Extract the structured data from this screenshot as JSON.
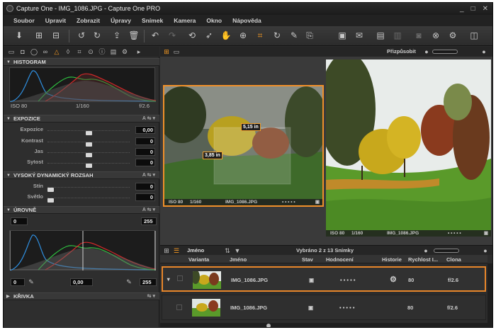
{
  "window": {
    "title": "Capture One - IMG_1086.JPG - Capture One PRO",
    "controls": [
      "_",
      "□",
      "✕"
    ]
  },
  "menu": [
    "Soubor",
    "Upravit",
    "Zobrazit",
    "Úpravy",
    "Snímek",
    "Kamera",
    "Okno",
    "Nápověda"
  ],
  "viewer_controls": {
    "customize_label": "Přizpůsobit"
  },
  "histogram": {
    "title": "HISTOGRAM",
    "iso": "ISO 80",
    "shutter": "1/160",
    "aperture": "f/2.6"
  },
  "exposure": {
    "title": "EXPOZICE",
    "rows": [
      {
        "label": "Expozice",
        "value": "0,00",
        "pos": 0.5
      },
      {
        "label": "Kontrast",
        "value": "0",
        "pos": 0.5
      },
      {
        "label": "Jas",
        "value": "0",
        "pos": 0.5
      },
      {
        "label": "Sytost",
        "value": "0",
        "pos": 0.5
      }
    ]
  },
  "hdr": {
    "title": "VYSOKÝ DYNAMICKÝ ROZSAH",
    "rows": [
      {
        "label": "Stín",
        "value": "0",
        "pos": 0
      },
      {
        "label": "Světlo",
        "value": "0",
        "pos": 0
      }
    ]
  },
  "levels": {
    "title": "ÚROVNĚ",
    "black_in": "0",
    "white_in": "255",
    "black_out": "0",
    "mid": "0,00",
    "white_out": "255"
  },
  "curve": {
    "title": "KŘIVKA"
  },
  "viewer": {
    "left_caption": {
      "iso": "ISO 80",
      "shutter": "1/160",
      "name": "IMG_1086.JPG"
    },
    "right_caption": {
      "iso": "ISO 80",
      "shutter": "1/160",
      "name": "IMG_1086.JPG"
    },
    "measure_w": "5,15 in",
    "measure_h": "3,85 in"
  },
  "browser": {
    "sort_label": "Jméno",
    "selection": "Vybráno 2 z 13 Snímky",
    "columns": [
      "Varianta",
      "Jméno",
      "Stav",
      "Hodnocení",
      "Historie",
      "Rychlost I...",
      "Clona"
    ],
    "rows": [
      {
        "name": "IMG_1086.JPG",
        "rating": "• • • • •",
        "speed": "80",
        "aperture": "f/2.6",
        "selected": true
      },
      {
        "name": "IMG_1086.JPG",
        "rating": "• • • • •",
        "speed": "80",
        "aperture": "f/2.6",
        "selected": false
      }
    ]
  },
  "colors": {
    "accent": "#f59a23",
    "panel": "#2e2e2e",
    "section": "#383838"
  }
}
